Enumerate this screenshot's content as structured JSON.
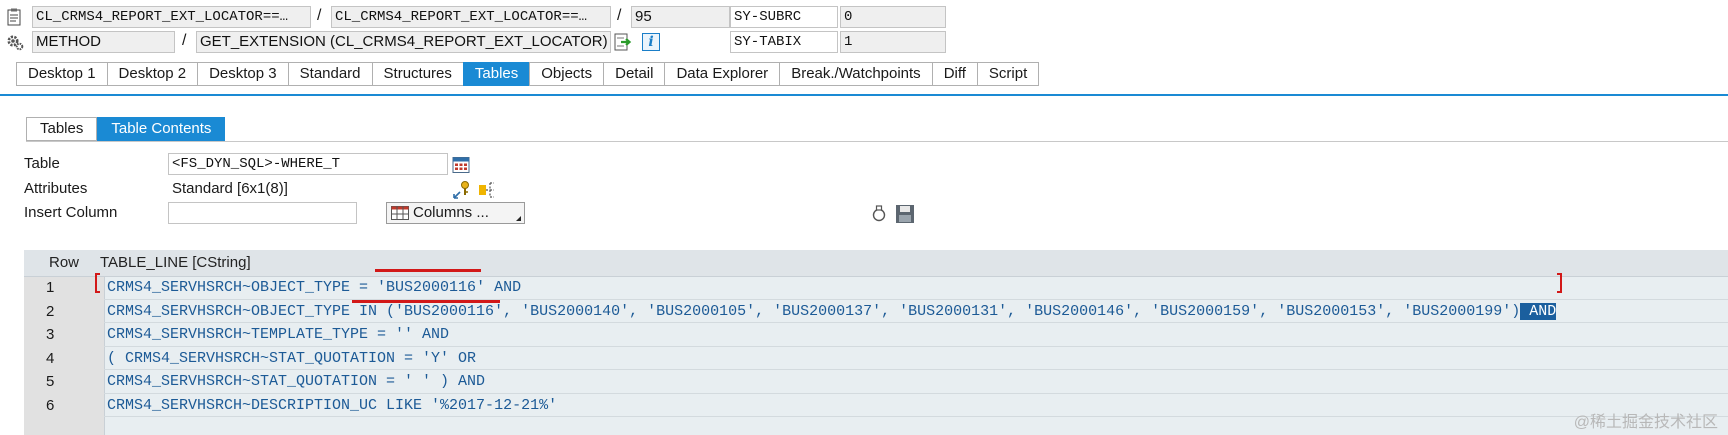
{
  "header": {
    "row1": {
      "program": "CL_CRMS4_REPORT_EXT_LOCATOR==…",
      "include": "CL_CRMS4_REPORT_EXT_LOCATOR==…",
      "line": "95",
      "sysvar": "SY-SUBRC",
      "sysval": "0"
    },
    "row2": {
      "type": "METHOD",
      "event": "GET_EXTENSION (CL_CRMS4_REPORT_EXT_LOCATOR)",
      "sysvar": "SY-TABIX",
      "sysval": "1"
    },
    "slash": "/",
    "info_glyph": "i"
  },
  "tabs": [
    "Desktop 1",
    "Desktop 2",
    "Desktop 3",
    "Standard",
    "Structures",
    "Tables",
    "Objects",
    "Detail",
    "Data Explorer",
    "Break./Watchpoints",
    "Diff",
    "Script"
  ],
  "active_tab": "Tables",
  "subtabs": [
    "Tables",
    "Table Contents"
  ],
  "active_subtab": "Table Contents",
  "form": {
    "table_label": "Table",
    "table_value": "<FS_DYN_SQL>-WHERE_T",
    "attributes_label": "Attributes",
    "attributes_value": "Standard [6x1(8)]",
    "insert_label": "Insert Column",
    "insert_value": "",
    "columns_button": "Columns ..."
  },
  "grid": {
    "col_row": "Row",
    "col_line": "TABLE_LINE [CString]",
    "rows": [
      {
        "row": "1",
        "text_before": "CRMS4_SERVHSRCH~OBJECT_TYPE = ",
        "text_sel": "",
        "text_after": "'BUS2000116' AND"
      },
      {
        "row": "2",
        "text_before": "CRMS4_SERVHSRCH~OBJECT_TYPE IN ('BUS2000116', 'BUS2000140', 'BUS2000105', 'BUS2000137', 'BUS2000131', 'BUS2000146', 'BUS2000159', 'BUS2000153', 'BUS2000199')",
        "text_sel": " AND",
        "text_after": ""
      },
      {
        "row": "3",
        "text_before": "CRMS4_SERVHSRCH~TEMPLATE_TYPE = '' AND",
        "text_sel": "",
        "text_after": ""
      },
      {
        "row": "4",
        "text_before": "( CRMS4_SERVHSRCH~STAT_QUOTATION = 'Y' OR",
        "text_sel": "",
        "text_after": ""
      },
      {
        "row": "5",
        "text_before": "CRMS4_SERVHSRCH~STAT_QUOTATION = ' ' ) AND",
        "text_sel": "",
        "text_after": ""
      },
      {
        "row": "6",
        "text_before": "CRMS4_SERVHSRCH~DESCRIPTION_UC LIKE '%2017-12-21%'",
        "text_sel": "",
        "text_after": ""
      }
    ]
  },
  "watermark": "@稀土掘金技术社区",
  "colors": {
    "accent": "#1a8ad4",
    "code_text": "#1c5a96",
    "annotation": "#d21818",
    "selection": "#1b5f9e"
  },
  "icons": [
    "program-icon",
    "settings-gear-icon",
    "navigate-icon",
    "info-icon",
    "calendar-table-icon",
    "attributes-key-icon",
    "hierarchy-icon",
    "columns-grid-icon",
    "dropdown-arrow-icon",
    "bulb-icon",
    "save-icon"
  ]
}
